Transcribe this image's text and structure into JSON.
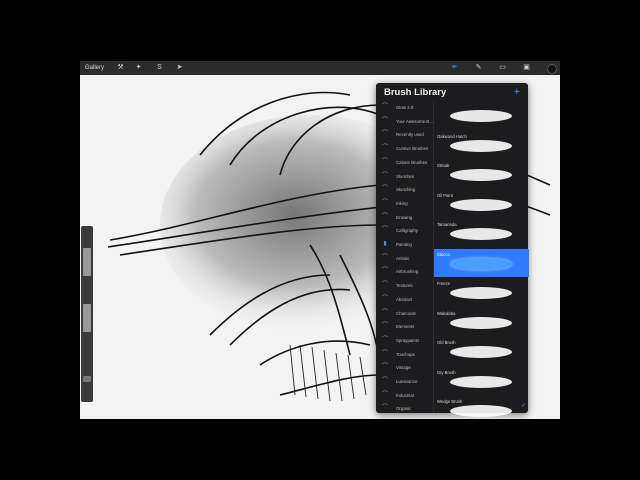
{
  "topbar": {
    "gallery": "Gallery",
    "left_icons": [
      "wrench-icon",
      "wand-icon",
      "s-icon",
      "arrow-icon"
    ],
    "right_icons": [
      "brush-icon",
      "smudge-icon",
      "eraser-icon",
      "layers-icon",
      "color-icon"
    ]
  },
  "panel": {
    "title": "Brush Library",
    "add": "+",
    "sets": [
      {
        "label": "Glow 2.0",
        "icon": "brush-set-icon"
      },
      {
        "label": "Your Awesome B...",
        "icon": "brush-set-icon"
      },
      {
        "label": "Recently used",
        "icon": "brush-set-icon"
      },
      {
        "label": "Cursive Brushes",
        "icon": "brush-set-icon"
      },
      {
        "label": "Calorie Brushes",
        "icon": "brush-set-icon"
      },
      {
        "label": "Sketches",
        "icon": "brush-set-icon"
      },
      {
        "label": "Sketching",
        "icon": "brush-set-icon"
      },
      {
        "label": "Inking",
        "icon": "brush-set-icon"
      },
      {
        "label": "Drawing",
        "icon": "brush-set-icon"
      },
      {
        "label": "Calligraphy",
        "icon": "brush-set-icon"
      },
      {
        "label": "Painting",
        "icon": "brush-set-icon",
        "active": true
      },
      {
        "label": "Artistic",
        "icon": "brush-set-icon"
      },
      {
        "label": "Airbrushing",
        "icon": "brush-set-icon"
      },
      {
        "label": "Textures",
        "icon": "brush-set-icon"
      },
      {
        "label": "Abstract",
        "icon": "brush-set-icon"
      },
      {
        "label": "Charcoals",
        "icon": "brush-set-icon"
      },
      {
        "label": "Elements",
        "icon": "brush-set-icon"
      },
      {
        "label": "Spraypaints",
        "icon": "brush-set-icon"
      },
      {
        "label": "Touchups",
        "icon": "brush-set-icon"
      },
      {
        "label": "Vintage",
        "icon": "brush-set-icon"
      },
      {
        "label": "Luminance",
        "icon": "brush-set-icon"
      },
      {
        "label": "Industrial",
        "icon": "brush-set-icon"
      },
      {
        "label": "Organic",
        "icon": "brush-set-icon"
      }
    ],
    "brushes": [
      {
        "name": ""
      },
      {
        "name": "Oakwood Hatch"
      },
      {
        "name": "Streak"
      },
      {
        "name": "Oil Paint"
      },
      {
        "name": "Tamarinda"
      },
      {
        "name": "Stucco",
        "selected": true
      },
      {
        "name": "Freeze"
      },
      {
        "name": "Wakaloba"
      },
      {
        "name": "Old Brush"
      },
      {
        "name": "Dry Brush"
      },
      {
        "name": "Wedge Brush"
      }
    ]
  },
  "colors": {
    "accent": "#3f8cff",
    "selected_row": "#2f7bff",
    "panel_bg": "#1c1c1e"
  }
}
